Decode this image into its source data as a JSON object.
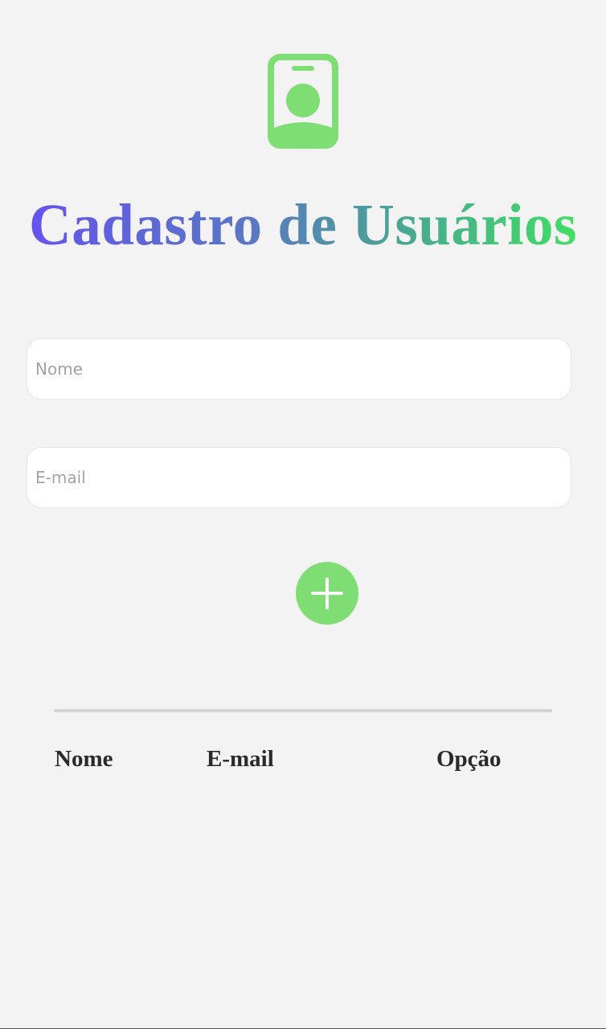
{
  "header": {
    "icon": "id-badge-icon",
    "title": "Cadastro de Usuários"
  },
  "form": {
    "name_placeholder": "Nome",
    "email_placeholder": "E-mail",
    "name_value": "",
    "email_value": "",
    "add_button_icon": "plus-icon"
  },
  "table": {
    "headers": [
      "Nome",
      "E-mail",
      "Opção"
    ],
    "rows": []
  },
  "colors": {
    "accent_green": "#7ede73",
    "title_gradient_start": "#6650f2",
    "title_gradient_end": "#3fe85c",
    "background": "#f3f3f3"
  }
}
